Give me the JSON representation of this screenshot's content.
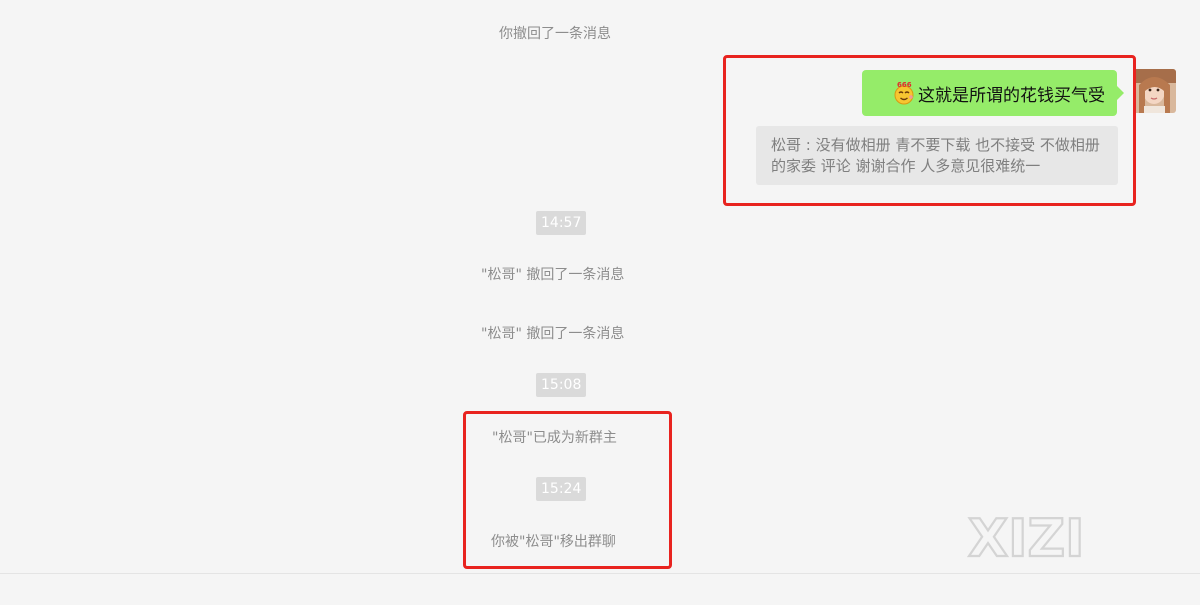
{
  "chat": {
    "recall_self": "你撤回了一条消息",
    "my_message": {
      "emoji": "666-emoji-icon",
      "text": "这就是所谓的花钱买气受"
    },
    "quote": {
      "text": "松哥 : 没有做相册 青不要下载  也不接受 不做相册的家委 评论 谢谢合作  人多意见很难统一"
    },
    "events": [
      {
        "time": "14:57"
      },
      {
        "text": "\"松哥\" 撤回了一条消息"
      },
      {
        "text": "\"松哥\" 撤回了一条消息"
      },
      {
        "time": "15:08"
      },
      {
        "text": "\"松哥\"已成为新群主"
      },
      {
        "time": "15:24"
      },
      {
        "text": "你被\"松哥\"移出群聊"
      }
    ]
  },
  "emoji_badge": "666",
  "watermark": "XIZI",
  "colors": {
    "background": "#f5f5f5",
    "my_bubble": "#95ec69",
    "quote_bg": "#e7e7e7",
    "timestamp_bg": "#dadada",
    "highlight": "#e8231f",
    "system_text": "#8d8d8d"
  }
}
